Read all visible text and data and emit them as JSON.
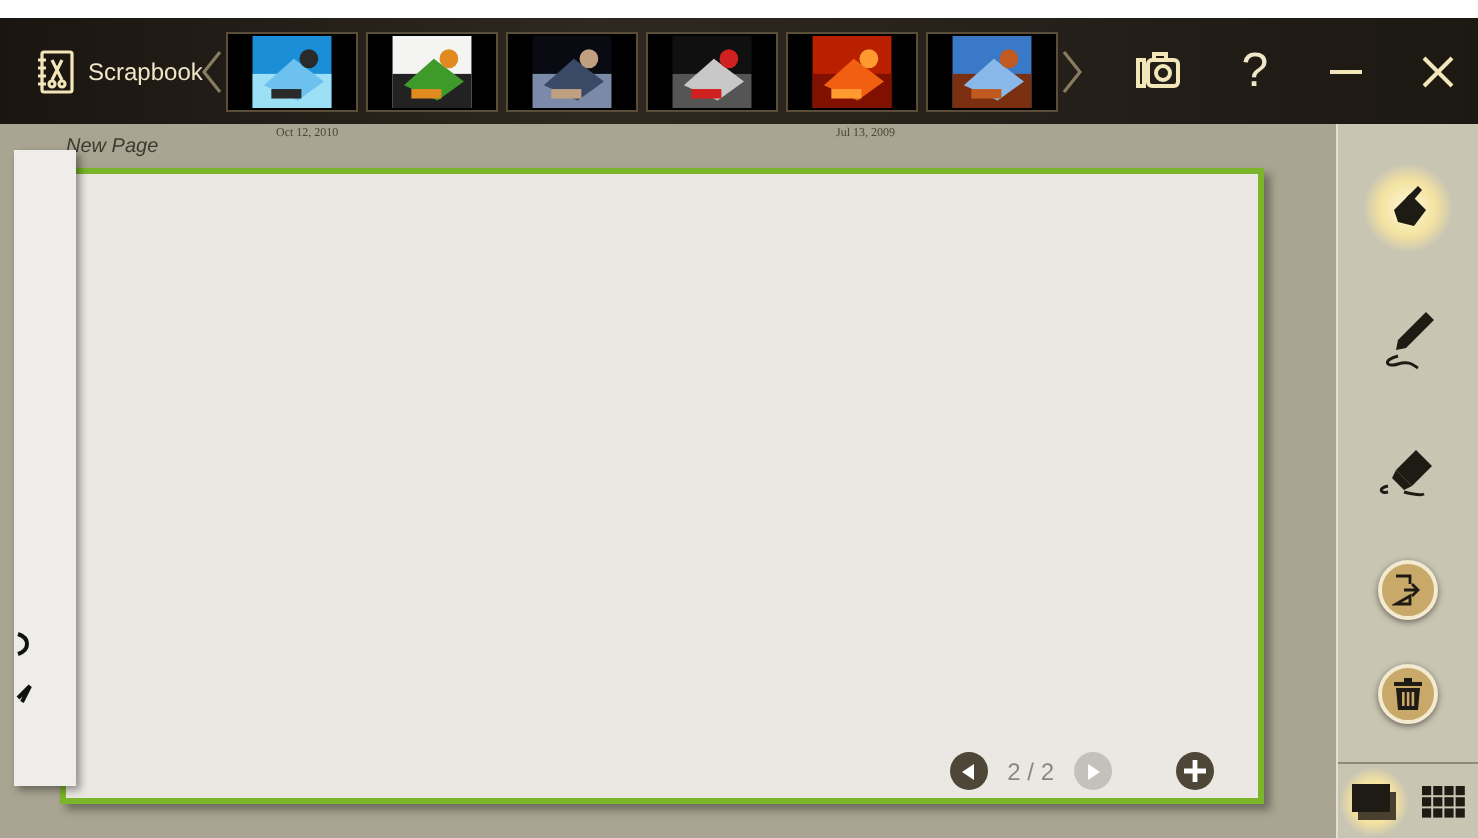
{
  "app": {
    "title": "Scrapbook"
  },
  "thumbnails": [
    {
      "kind": "picture",
      "date": "Oct 12, 2010"
    },
    {
      "kind": "picture"
    },
    {
      "kind": "picture"
    },
    {
      "kind": "picture"
    },
    {
      "kind": "picture",
      "date": "Jul 13, 2009"
    },
    {
      "kind": "picture"
    }
  ],
  "header_buttons": [
    {
      "kind": "camera"
    },
    {
      "kind": "help",
      "label": "?"
    },
    {
      "kind": "minimize"
    },
    {
      "kind": "close"
    }
  ],
  "page": {
    "title": "New Page",
    "page_indicator": "2 / 2",
    "prev_disabled": false,
    "next_disabled": true
  },
  "tools": [
    {
      "kind": "select",
      "selected": true
    },
    {
      "kind": "pen",
      "selected": false
    },
    {
      "kind": "eraser",
      "selected": false
    },
    {
      "kind": "export",
      "selected": false
    },
    {
      "kind": "delete",
      "selected": false
    }
  ],
  "views": [
    {
      "kind": "page",
      "selected": true
    },
    {
      "kind": "grid",
      "selected": false
    }
  ]
}
